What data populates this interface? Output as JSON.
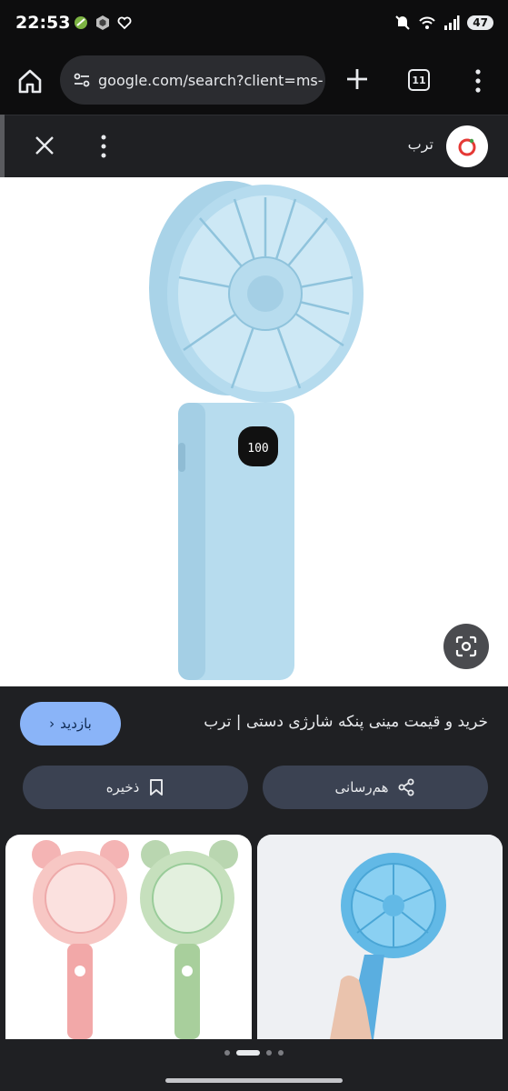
{
  "status_bar": {
    "time": "22:53",
    "battery": "47",
    "icons": [
      "notification-icon",
      "app-icon",
      "heart-icon",
      "mute-icon",
      "wifi-icon",
      "signal-icon"
    ]
  },
  "toolbar": {
    "url": "google.com/search?client=ms-",
    "tab_count": "11"
  },
  "panel": {
    "source_name": "ترب",
    "brand_color": "#e53935"
  },
  "result": {
    "title": "خرید و قیمت مینی پنکه شارژی دستی | ترب",
    "visit_label": "بازدید",
    "share_label": "هم‌رسانی",
    "save_label": "ذخیره",
    "fan_display": "100"
  },
  "carousel": {
    "pages": 4,
    "active_index": 1
  }
}
